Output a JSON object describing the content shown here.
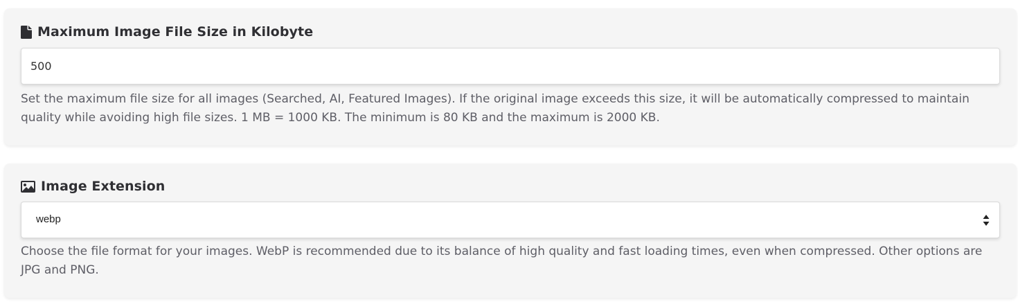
{
  "max_size_section": {
    "title": "Maximum Image File Size in Kilobyte",
    "icon": "file-icon",
    "input_value": "500",
    "help_text": "Set the maximum file size for all images (Searched, AI, Featured Images). If the original image exceeds this size, it will be automatically compressed to maintain quality while avoiding high file sizes. 1 MB = 1000 KB. The minimum is 80 KB and the maximum is 2000 KB."
  },
  "extension_section": {
    "title": "Image Extension",
    "icon": "image-icon",
    "selected_value": "webp",
    "help_text": "Choose the file format for your images. WebP is recommended due to its balance of high quality and fast loading times, even when compressed. Other options are JPG and PNG."
  },
  "colors": {
    "card_background": "#f5f5f5",
    "title_text": "#2f2f33",
    "help_text": "#5e5e66"
  }
}
